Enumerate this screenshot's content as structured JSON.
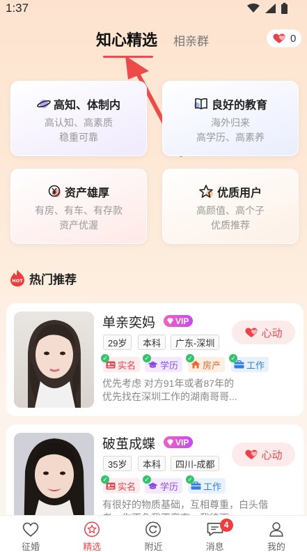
{
  "status": {
    "time": "1:37"
  },
  "header": {
    "active_tab": "知心精选",
    "other_tab": "相亲群",
    "coin_count": "0"
  },
  "categories": [
    {
      "title": "高知、体制内",
      "line1": "高认知、高素质",
      "line2": "稳重可靠",
      "icon": "planet-icon"
    },
    {
      "title": "良好的教育",
      "line1": "海外归来",
      "line2": "高学历、高素养",
      "icon": "book-icon"
    },
    {
      "title": "资产雄厚",
      "line1": "有房、有车、有存款",
      "line2": "资产优渥",
      "icon": "yen-coin-icon"
    },
    {
      "title": "优质用户",
      "line1": "高颜值、高个子",
      "line2": "优质推荐",
      "icon": "star-icon"
    }
  ],
  "hot": {
    "title": "热门推荐",
    "badge": "HOT"
  },
  "profiles": [
    {
      "name": "单亲奕妈",
      "vip": "VIP",
      "tags": [
        "29岁",
        "本科",
        "广东-深圳"
      ],
      "verify": [
        "实名",
        "学历",
        "房产",
        "工作"
      ],
      "desc_line1": "优先考虑 对方91年或者87年的",
      "desc_line2": "优先找在深圳工作的湖南哥哥...",
      "action": "心动"
    },
    {
      "name": "破茧成蝶",
      "vip": "VIP",
      "tags": [
        "35岁",
        "本科",
        "四川-成都"
      ],
      "verify": [
        "实名",
        "学历",
        "工作"
      ],
      "desc_line1": "有很好的物质基础，互相尊重，白头偕",
      "desc_line2": "老，你不负我不离弃，我待下",
      "action": "心动"
    }
  ],
  "nav": [
    {
      "label": "征婚",
      "icon": "heart-outline-icon"
    },
    {
      "label": "精选",
      "icon": "star-circle-icon"
    },
    {
      "label": "附近",
      "icon": "refresh-circle-icon"
    },
    {
      "label": "消息",
      "icon": "chat-bubble-icon",
      "badge": "4"
    },
    {
      "label": "我的",
      "icon": "person-icon"
    }
  ],
  "colors": {
    "accent": "#e84a4f",
    "vip": "#d44ae8",
    "background": "#fde3cf"
  }
}
